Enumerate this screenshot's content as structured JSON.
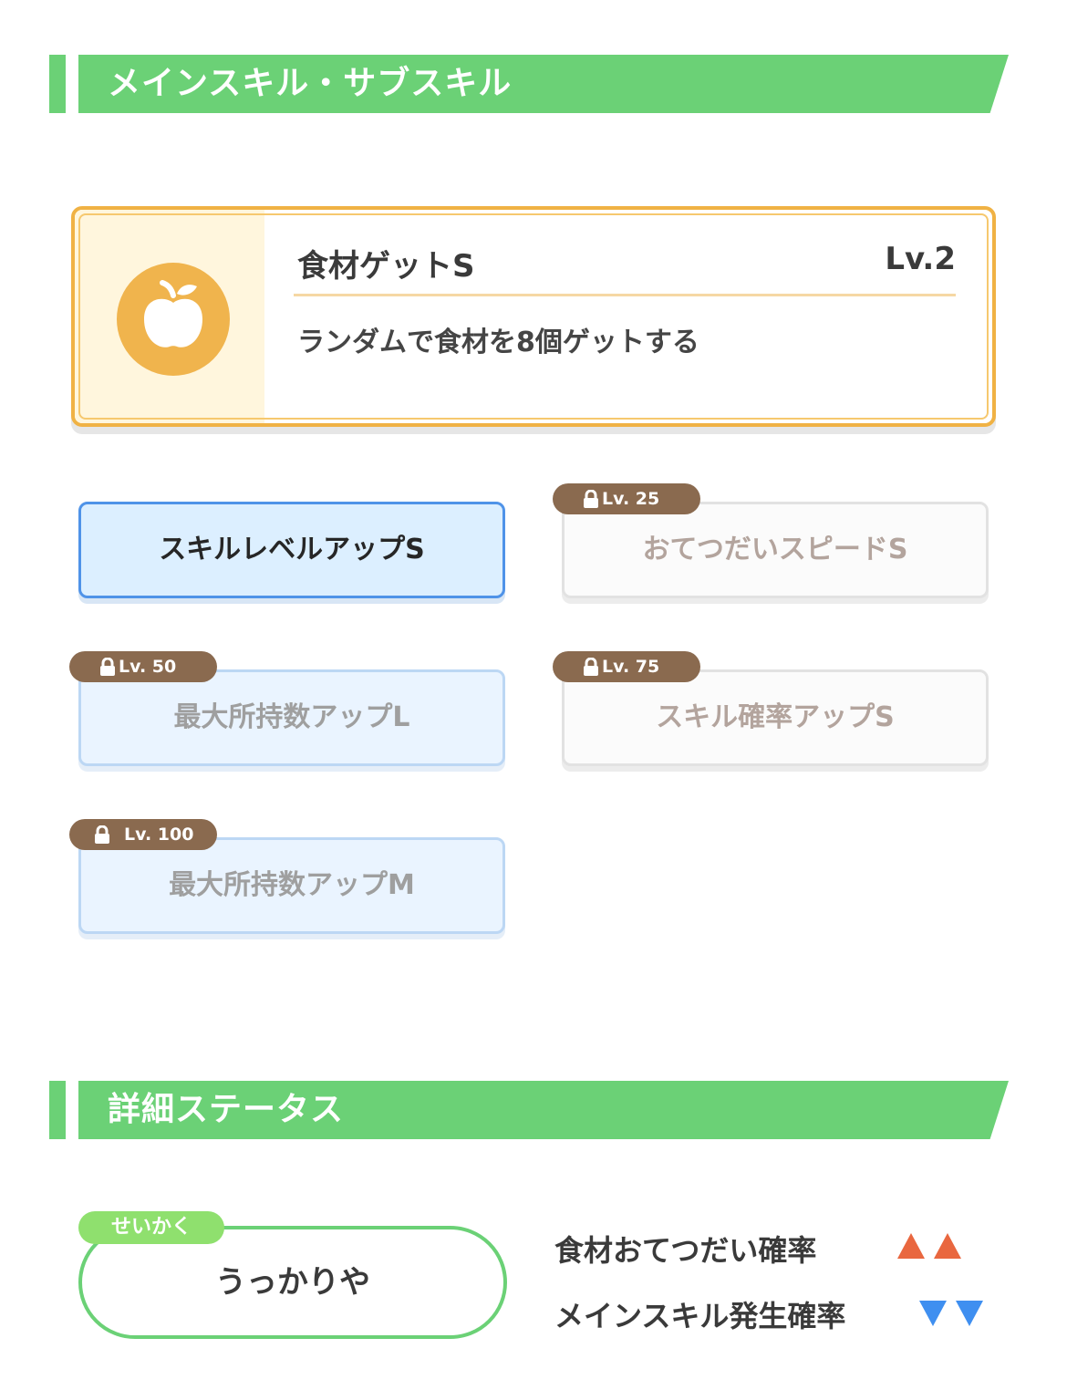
{
  "skills_section": {
    "title": "メインスキル・サブスキル"
  },
  "main_skill": {
    "icon": "apple-icon",
    "name": "食材ゲットS",
    "level": "Lv.2",
    "description": "ランダムで食材を8個ゲットする",
    "colors": {
      "border": "#f0b244",
      "icon_bg": "#f0b44d",
      "panel_bg": "#fff6dd"
    }
  },
  "sub_skills": [
    {
      "label": "スキルレベルアップS",
      "lock_level": null,
      "state": "unlocked"
    },
    {
      "label": "おてつだいスピードS",
      "lock_level": "Lv. 25",
      "state": "locked"
    },
    {
      "label": "最大所持数アップL",
      "lock_level": "Lv. 50",
      "state": "locked"
    },
    {
      "label": "スキル確率アップS",
      "lock_level": "Lv. 75",
      "state": "locked"
    },
    {
      "label": "最大所持数アップM",
      "lock_level": "Lv. 100",
      "state": "locked"
    }
  ],
  "status_section": {
    "title": "詳細ステータス"
  },
  "nature": {
    "tag": "せいかく",
    "value": "うっかりや",
    "effects": [
      {
        "label": "食材おてつだい確率",
        "direction": "up",
        "count": 2,
        "color": "#e9673f"
      },
      {
        "label": "メインスキル発生確率",
        "direction": "down",
        "count": 2,
        "color": "#3f8ff0"
      }
    ]
  },
  "colors": {
    "accent_green": "#6bd176",
    "active_blue": "#4f93e8",
    "lock_brown": "#8a6a4f"
  }
}
